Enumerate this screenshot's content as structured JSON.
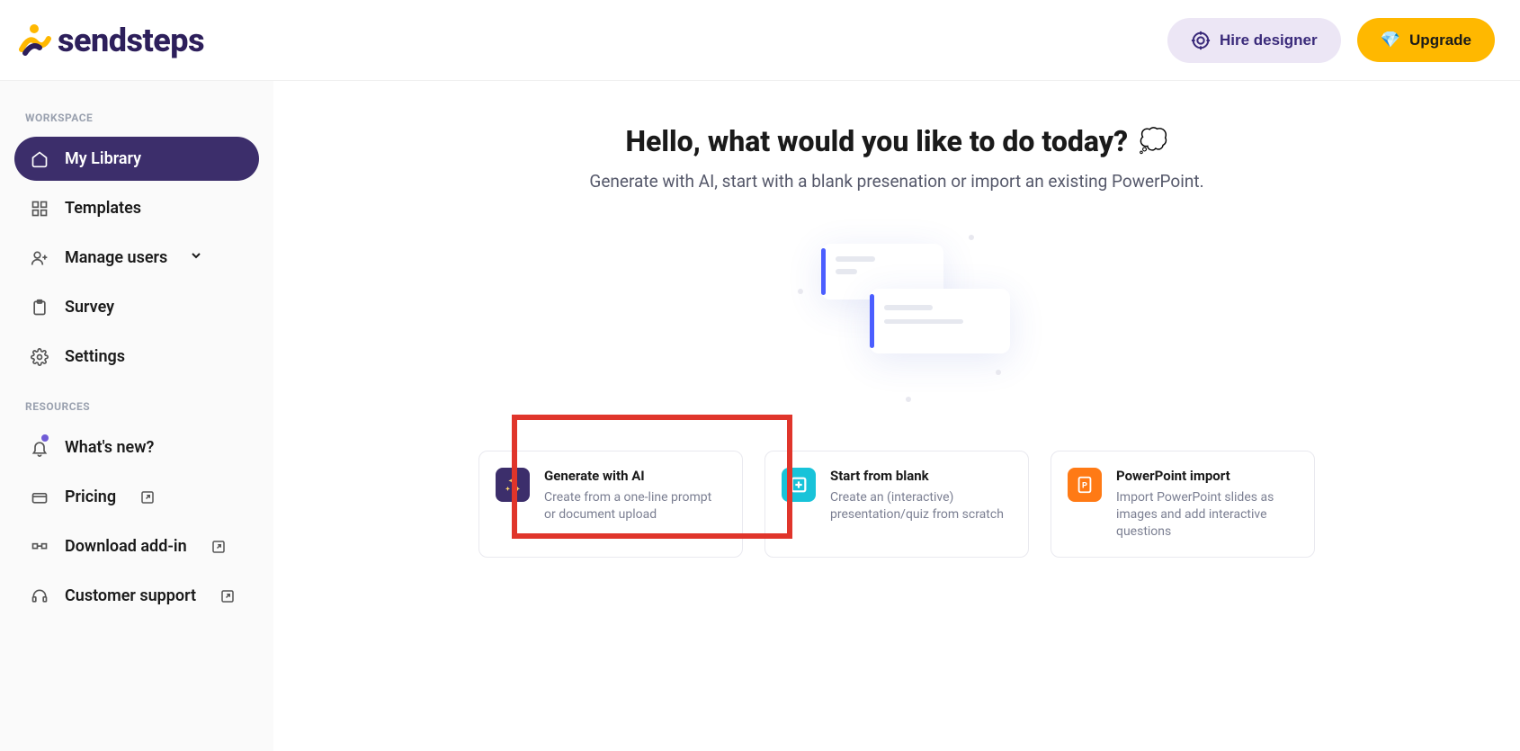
{
  "brand": "sendsteps",
  "header": {
    "hire_label": "Hire designer",
    "upgrade_label": "Upgrade"
  },
  "sidebar": {
    "workspace_heading": "WORKSPACE",
    "resources_heading": "RESOURCES",
    "workspace": [
      {
        "label": "My Library"
      },
      {
        "label": "Templates"
      },
      {
        "label": "Manage users"
      },
      {
        "label": "Survey"
      },
      {
        "label": "Settings"
      }
    ],
    "resources": [
      {
        "label": "What's new?"
      },
      {
        "label": "Pricing"
      },
      {
        "label": "Download add-in"
      },
      {
        "label": "Customer support"
      }
    ]
  },
  "hero": {
    "title": "Hello, what would you like to do today?",
    "subtitle": "Generate with AI, start with a blank presenation or import an existing PowerPoint."
  },
  "options": {
    "ai": {
      "title": "Generate with AI",
      "desc": "Create from a one-line prompt or document upload"
    },
    "blank": {
      "title": "Start from blank",
      "desc": "Create an (interactive) presentation/quiz from scratch"
    },
    "ppt": {
      "title": "PowerPoint import",
      "desc": "Import PowerPoint slides as images and add interactive questions"
    }
  }
}
